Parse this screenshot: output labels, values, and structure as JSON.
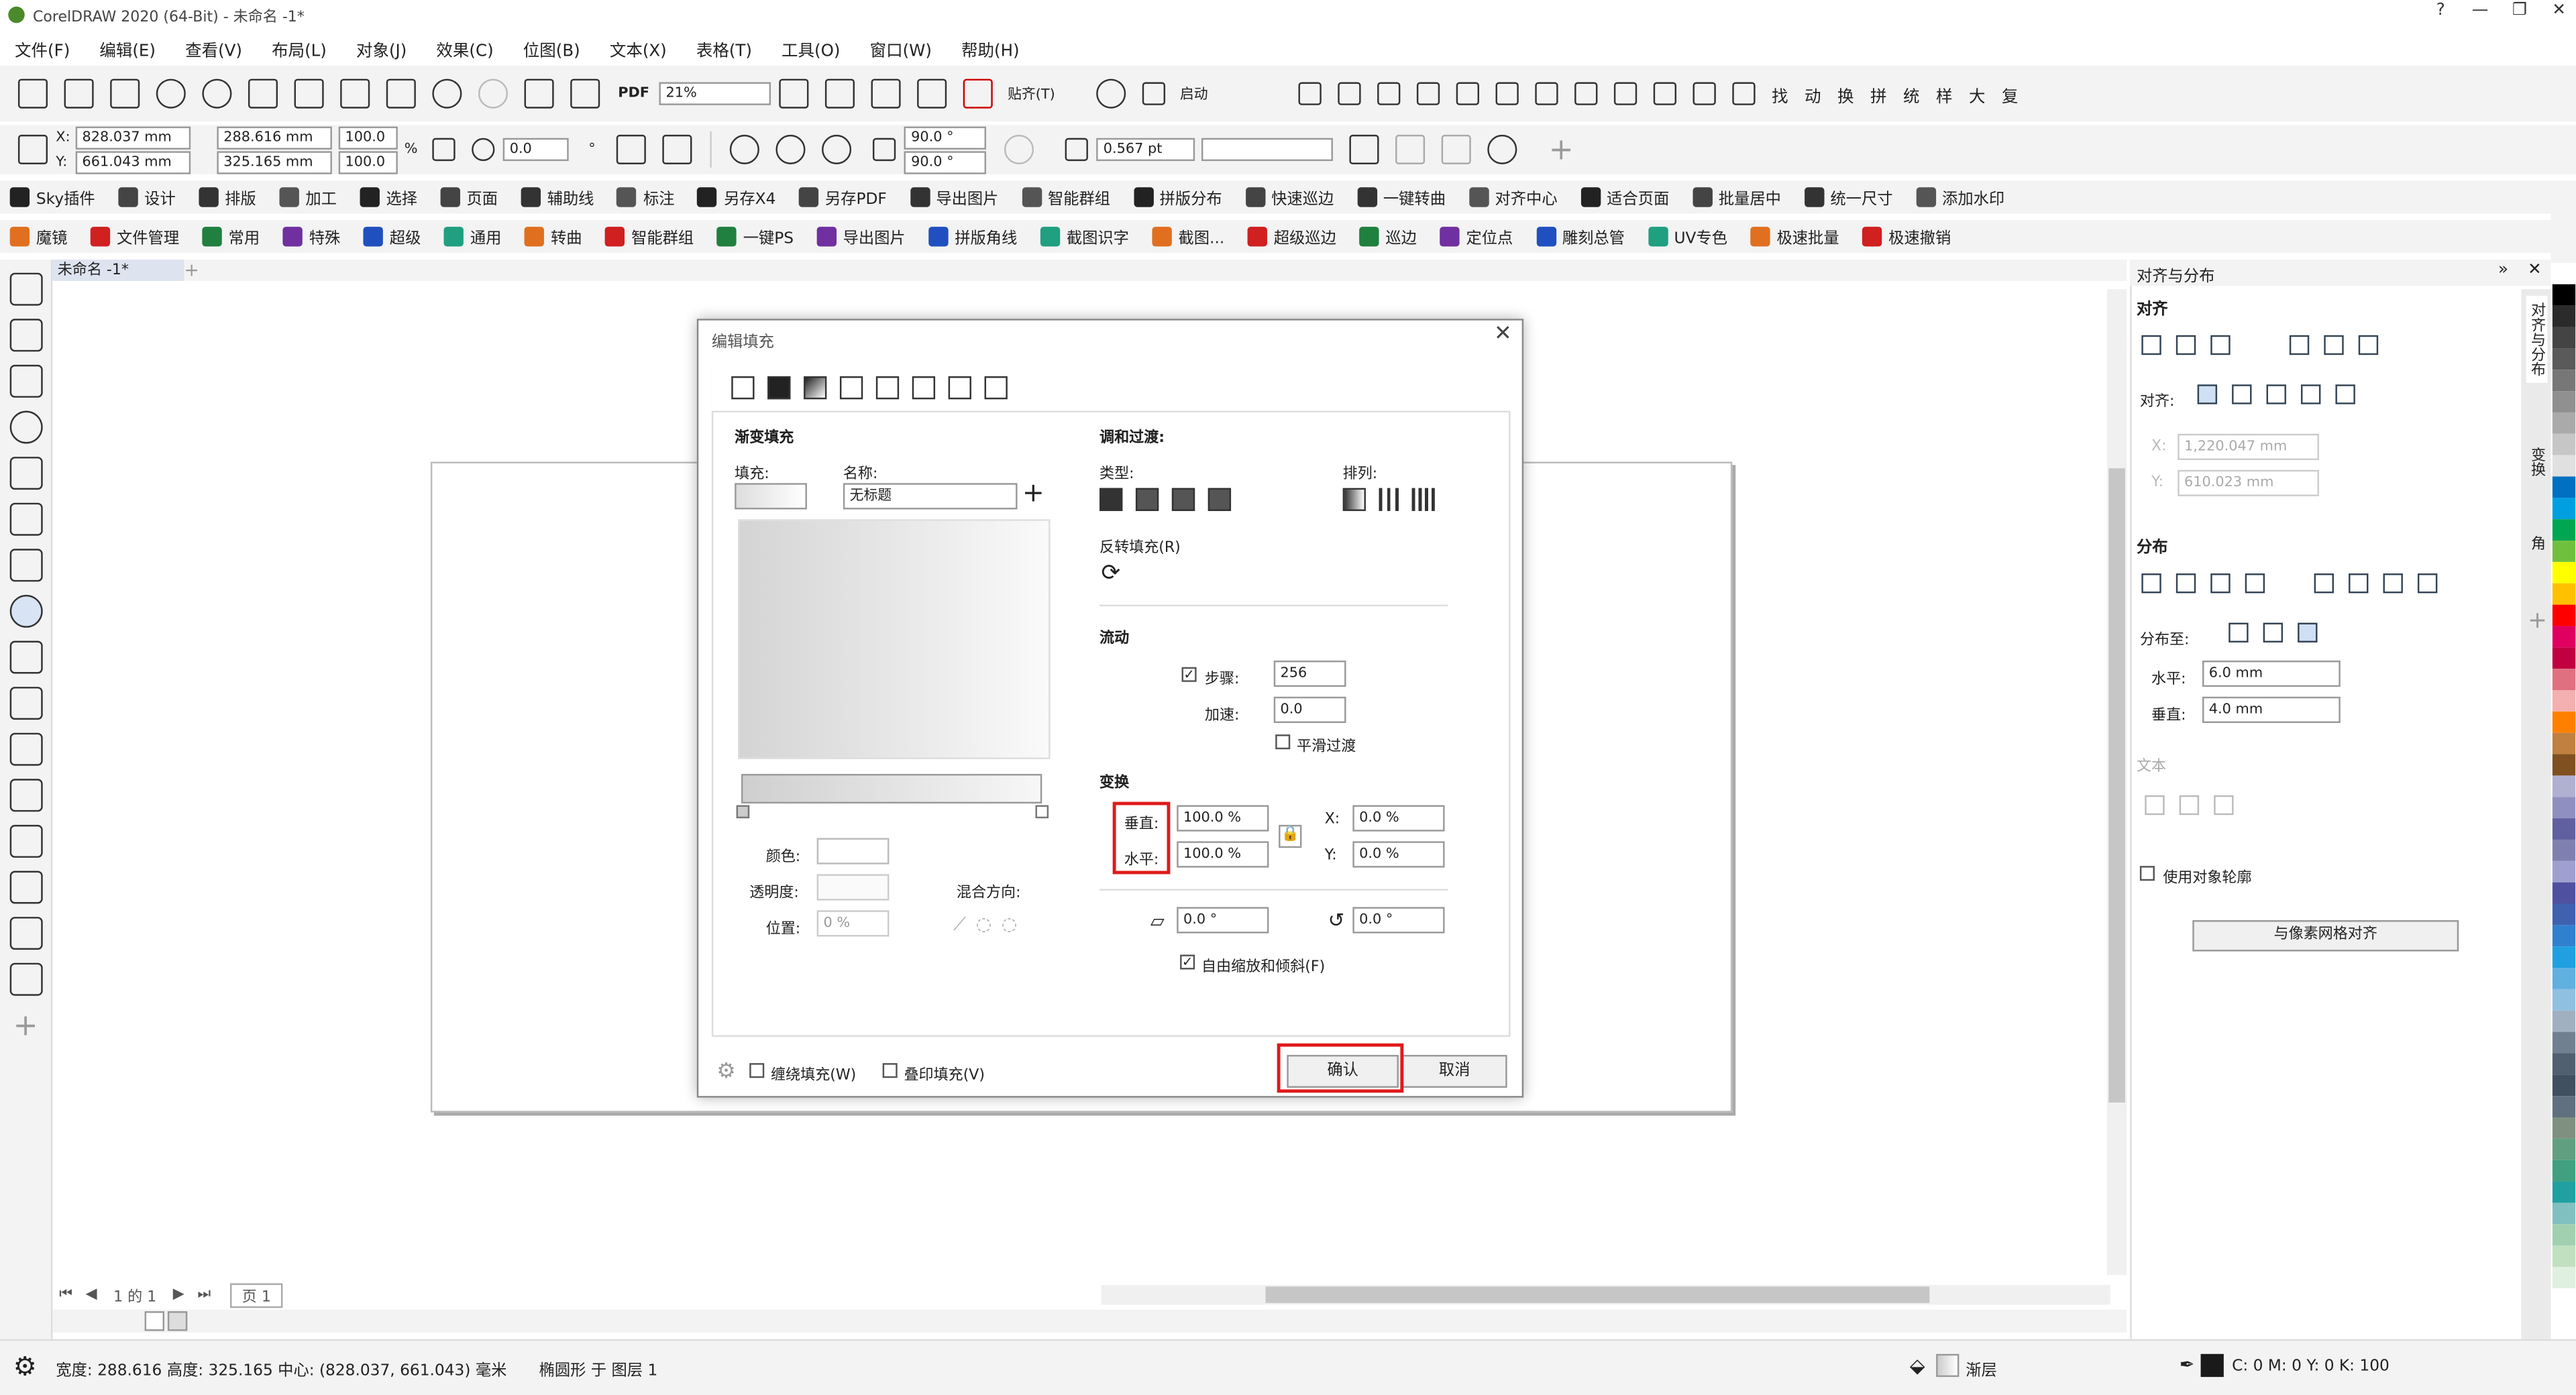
{
  "window": {
    "title": "CorelDRAW 2020 (64-Bit) - 未命名 -1*"
  },
  "menu": [
    "文件(F)",
    "编辑(E)",
    "查看(V)",
    "布局(L)",
    "对象(J)",
    "效果(C)",
    "位图(B)",
    "文本(X)",
    "表格(T)",
    "工具(O)",
    "窗口(W)",
    "帮助(H)"
  ],
  "std": {
    "zoom": "21%",
    "snap": "贴齐(T)",
    "launch": "启动",
    "pdf": "PDF"
  },
  "quick_labels": [
    "找",
    "动",
    "换",
    "拼",
    "统",
    "样",
    "大",
    "复"
  ],
  "props": {
    "x": "828.037 mm",
    "y": "661.043 mm",
    "w": "288.616 mm",
    "h": "325.165 mm",
    "sx": "100.0",
    "sy": "100.0",
    "pct": "%",
    "rot": "0.0",
    "deg": "°",
    "a1": "90.0 °",
    "a2": "90.0 °",
    "outline": "0.567 pt"
  },
  "plugin_bar": [
    "Sky插件",
    "设计",
    "排版",
    "加工",
    "选择",
    "页面",
    "辅助线",
    "标注",
    "另存X4",
    "另存PDF",
    "导出图片",
    "智能群组",
    "拼版分布",
    "快速巡边",
    "一键转曲",
    "对齐中心",
    "适合页面",
    "批量居中",
    "统一尺寸",
    "添加水印"
  ],
  "plugin_bar2": [
    "魔镜",
    "文件管理",
    "常用",
    "特殊",
    "超级",
    "通用",
    "转曲",
    "智能群组",
    "一键PS",
    "导出图片",
    "拼版角线",
    "截图识字",
    "截图...",
    "超级巡边",
    "巡边",
    "定位点",
    "雕刻总管",
    "UV专色",
    "极速批量",
    "极速撤销"
  ],
  "doc": {
    "tab": "未命名 -1*",
    "page_label": "页 1",
    "page_count": "1 的 1"
  },
  "dialog": {
    "title": "编辑填充",
    "grad_title": "渐变填充",
    "fill_label": "填充:",
    "name_label": "名称:",
    "name_value": "无标题",
    "blend_title": "调和过渡:",
    "type_label": "类型:",
    "arrange_label": "排列:",
    "reverse_label": "反转填充(R)",
    "flow_title": "流动",
    "steps_label": "步骤:",
    "steps_value": "256",
    "accel_label": "加速:",
    "accel_value": "0.0",
    "smooth_label": "平滑过渡",
    "transform_title": "变换",
    "vert_label": "垂直:",
    "horz_label": "水平:",
    "vert_value": "100.0 %",
    "horz_value": "100.0 %",
    "x_label": "X:",
    "y_label": "Y:",
    "x_value": "0.0 %",
    "y_value": "0.0 %",
    "skew_value": "0.0 °",
    "rot_value": "0.0 °",
    "free_label": "自由缩放和倾斜(F)",
    "color_label": "颜色:",
    "trans_label": "透明度:",
    "pos_label": "位置:",
    "pos_value": "0 %",
    "mixdir_label": "混合方向:",
    "wrap_label": "缠绕填充(W)",
    "overprint_label": "叠印填充(V)",
    "ok": "确认",
    "cancel": "取消"
  },
  "panel": {
    "title": "对齐与分布",
    "align": "对齐",
    "align_to": "对齐:",
    "x_value": "1,220.047 mm",
    "y_value": "610.023 mm",
    "x_label": "X:",
    "y_label": "Y:",
    "distribute": "分布",
    "distribute_to": "分布至:",
    "horz_label": "水平:",
    "horz_value": "6.0 mm",
    "vert_label": "垂直:",
    "vert_value": "4.0 mm",
    "text": "文本",
    "use_outline": "使用对象轮廓",
    "pixel_grid": "与像素网格对齐",
    "dock_tabs": [
      "对齐与分布",
      "变换",
      "角"
    ]
  },
  "status": {
    "info": "宽度:  288.616  高度:  325.165  中心:  (828.037, 661.043)  毫米",
    "layer": "椭圆形 于 图层 1",
    "fill": "渐层",
    "cmyk": "C: 0 M: 0 Y: 0 K: 100"
  },
  "palette": [
    "#ffffff",
    "#000000",
    "#2b2b2b",
    "#444",
    "#5a5a5a",
    "#777",
    "#909090",
    "#aaa",
    "#c6c6c6",
    "#e0e0e0",
    "#0070c0",
    "#00a0e0",
    "#00a651",
    "#70c040",
    "#ffff00",
    "#ffc000",
    "#ff0000",
    "#e00060",
    "#c00040",
    "#e07080",
    "#f4b0b0",
    "#ff8000",
    "#c08040",
    "#805020",
    "#b0b0d0",
    "#9090c0",
    "#6060a0",
    "#8080b0",
    "#a0a0d0",
    "#5050a0",
    "#4060b0",
    "#3080d0",
    "#20a0e0",
    "#60b0e0",
    "#90c0e0",
    "#a0b0c0",
    "#708090",
    "#506070",
    "#405060",
    "#607080",
    "#809080",
    "#60a080",
    "#40a080",
    "#20a0a0",
    "#80c0c0",
    "#a0d0b0",
    "#c0e0c0",
    "#e0f0e0"
  ]
}
